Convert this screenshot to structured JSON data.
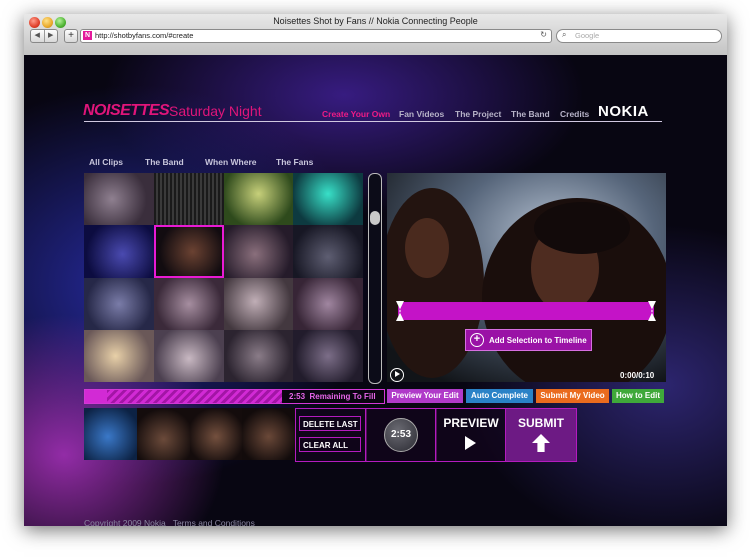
{
  "browser": {
    "window_title": "Noisettes Shot by Fans // Nokia Connecting People",
    "back_icon": "◀",
    "forward_icon": "▶",
    "url": "http://shotbyfans.com/#create",
    "search_placeholder": "Google"
  },
  "site": {
    "logo": "NOISETTES",
    "subtitle": "Saturday Night",
    "nav": [
      {
        "label": "Create Your Own",
        "active": true
      },
      {
        "label": "Fan Videos",
        "active": false
      },
      {
        "label": "The Project",
        "active": false
      },
      {
        "label": "The Band",
        "active": false
      },
      {
        "label": "Credits",
        "active": false
      }
    ],
    "brand": "NOKIA",
    "accent": "#e0157a"
  },
  "filters": [
    "All Clips",
    "The Band",
    "When Where",
    "The Fans"
  ],
  "clips": {
    "selected_index": 5,
    "count": 16
  },
  "player": {
    "add_selection_label": "Add Selection to Timeline",
    "timecode": "0:00/0:10"
  },
  "progress": {
    "remaining_time": "2:53",
    "remaining_label": "Remaining To Fill",
    "fill_fraction": 0.66
  },
  "actions": [
    {
      "label": "Preview Your Edit",
      "color": "#b03ac9"
    },
    {
      "label": "Auto Complete",
      "color": "#2a82c7"
    },
    {
      "label": "Submit My Video",
      "color": "#ea6b1e"
    },
    {
      "label": "How to Edit",
      "color": "#3fa83a"
    }
  ],
  "timeline": {
    "delete_last": "DELETE LAST",
    "clear_all": "CLEAR ALL",
    "time": "2:53",
    "preview": "PREVIEW",
    "submit": "SUBMIT"
  },
  "footer": {
    "copyright": "Copyright 2009 Nokia",
    "terms": "Terms and Conditions"
  }
}
